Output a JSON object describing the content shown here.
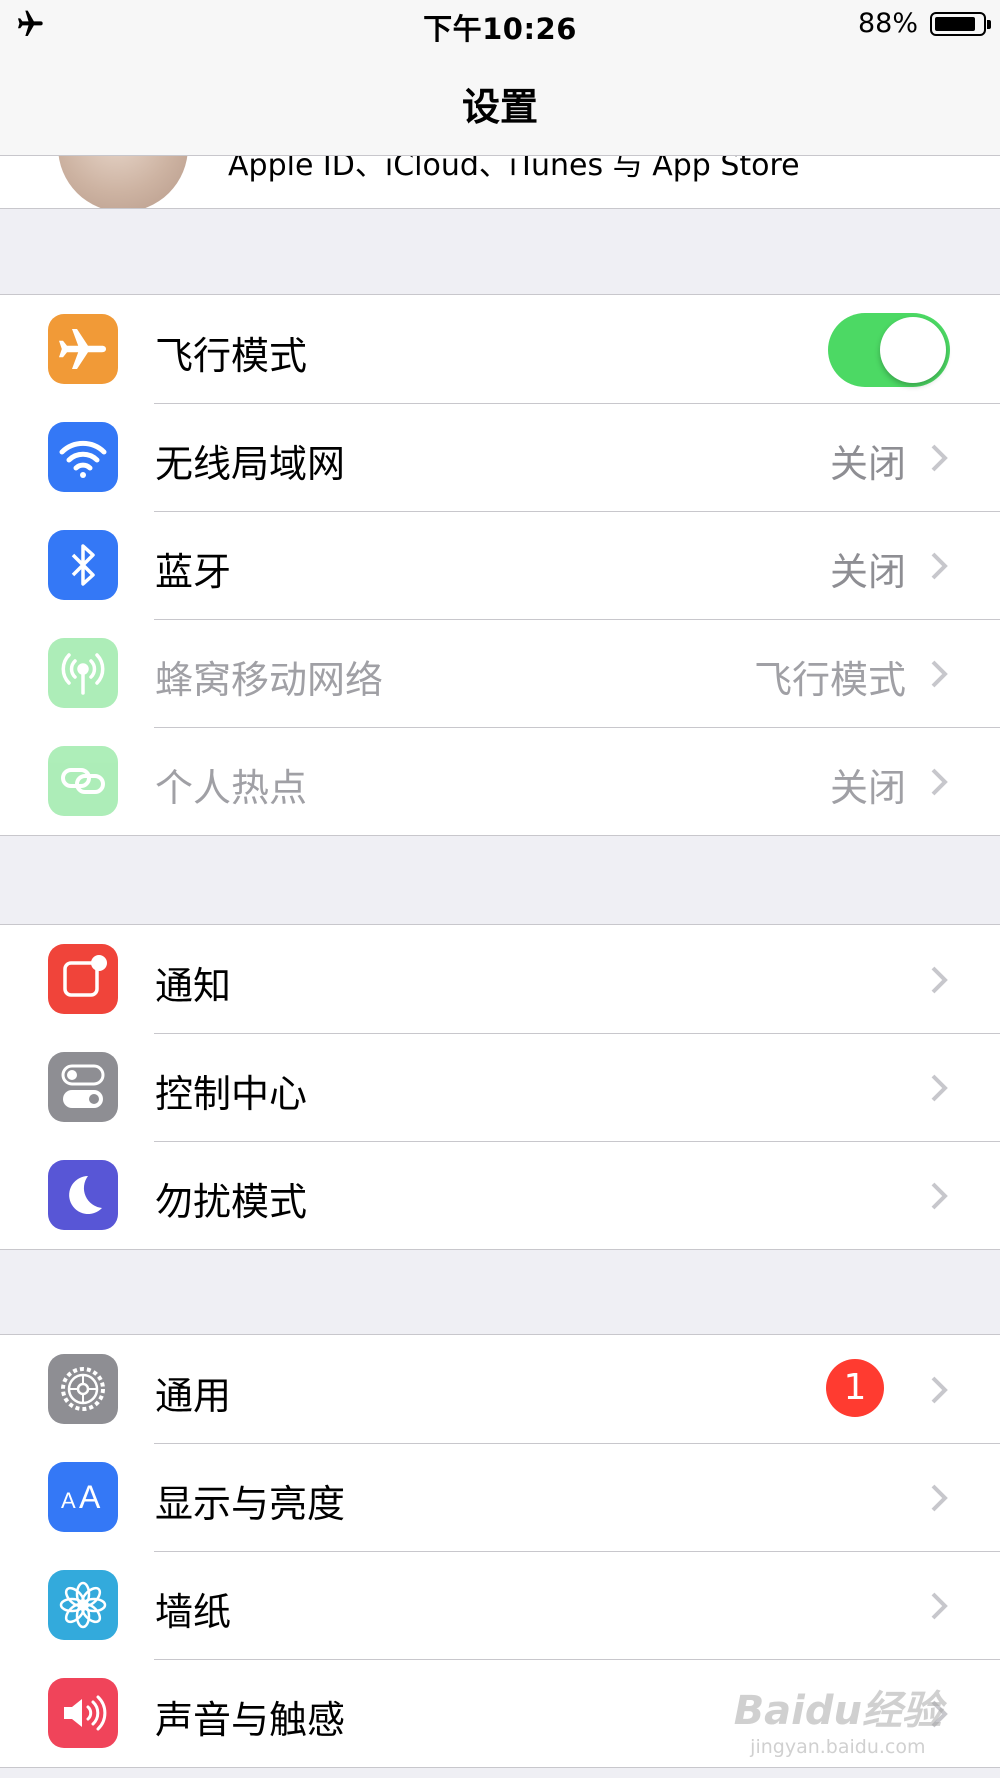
{
  "status_bar": {
    "time": "下午10:26",
    "battery_percent": "88%",
    "battery_level": 0.88,
    "left_icon": "airplane-icon"
  },
  "nav": {
    "title": "设置"
  },
  "profile": {
    "subtitle": "Apple ID、iCloud、iTunes 与 App Store"
  },
  "group1": [
    {
      "icon": "airplane-icon",
      "icon_color": "#f19a37",
      "label": "飞行模式",
      "toggle_on": true
    },
    {
      "icon": "wifi-icon",
      "icon_color": "#3478f6",
      "label": "无线局域网",
      "value": "关闭"
    },
    {
      "icon": "bluetooth-icon",
      "icon_color": "#3478f6",
      "label": "蓝牙",
      "value": "关闭"
    },
    {
      "icon": "cellular-icon",
      "icon_color": "#4cd964",
      "label": "蜂窝移动网络",
      "value": "飞行模式",
      "disabled": true
    },
    {
      "icon": "hotspot-icon",
      "icon_color": "#4cd964",
      "label": "个人热点",
      "value": "关闭",
      "disabled": true
    }
  ],
  "group2": [
    {
      "icon": "notifications-icon",
      "icon_color": "#f0443a",
      "label": "通知"
    },
    {
      "icon": "control-center-icon",
      "icon_color": "#8e8e93",
      "label": "控制中心"
    },
    {
      "icon": "moon-icon",
      "icon_color": "#5856d6",
      "label": "勿扰模式"
    }
  ],
  "group3": [
    {
      "icon": "gear-icon",
      "icon_color": "#8e8e93",
      "label": "通用",
      "badge": "1"
    },
    {
      "icon": "display-icon",
      "icon_color": "#3478f6",
      "label": "显示与亮度"
    },
    {
      "icon": "flower-icon",
      "icon_color": "#33aadc",
      "label": "墙纸"
    },
    {
      "icon": "speaker-icon",
      "icon_color": "#f0445a",
      "label": "声音与触感"
    }
  ],
  "watermark": {
    "main": "Baidu经验",
    "sub": "jingyan.baidu.com"
  },
  "colors": {
    "accent": "#4cd964",
    "badge": "#ff3b30",
    "separator": "#c8c7cc",
    "background": "#efeff4"
  }
}
